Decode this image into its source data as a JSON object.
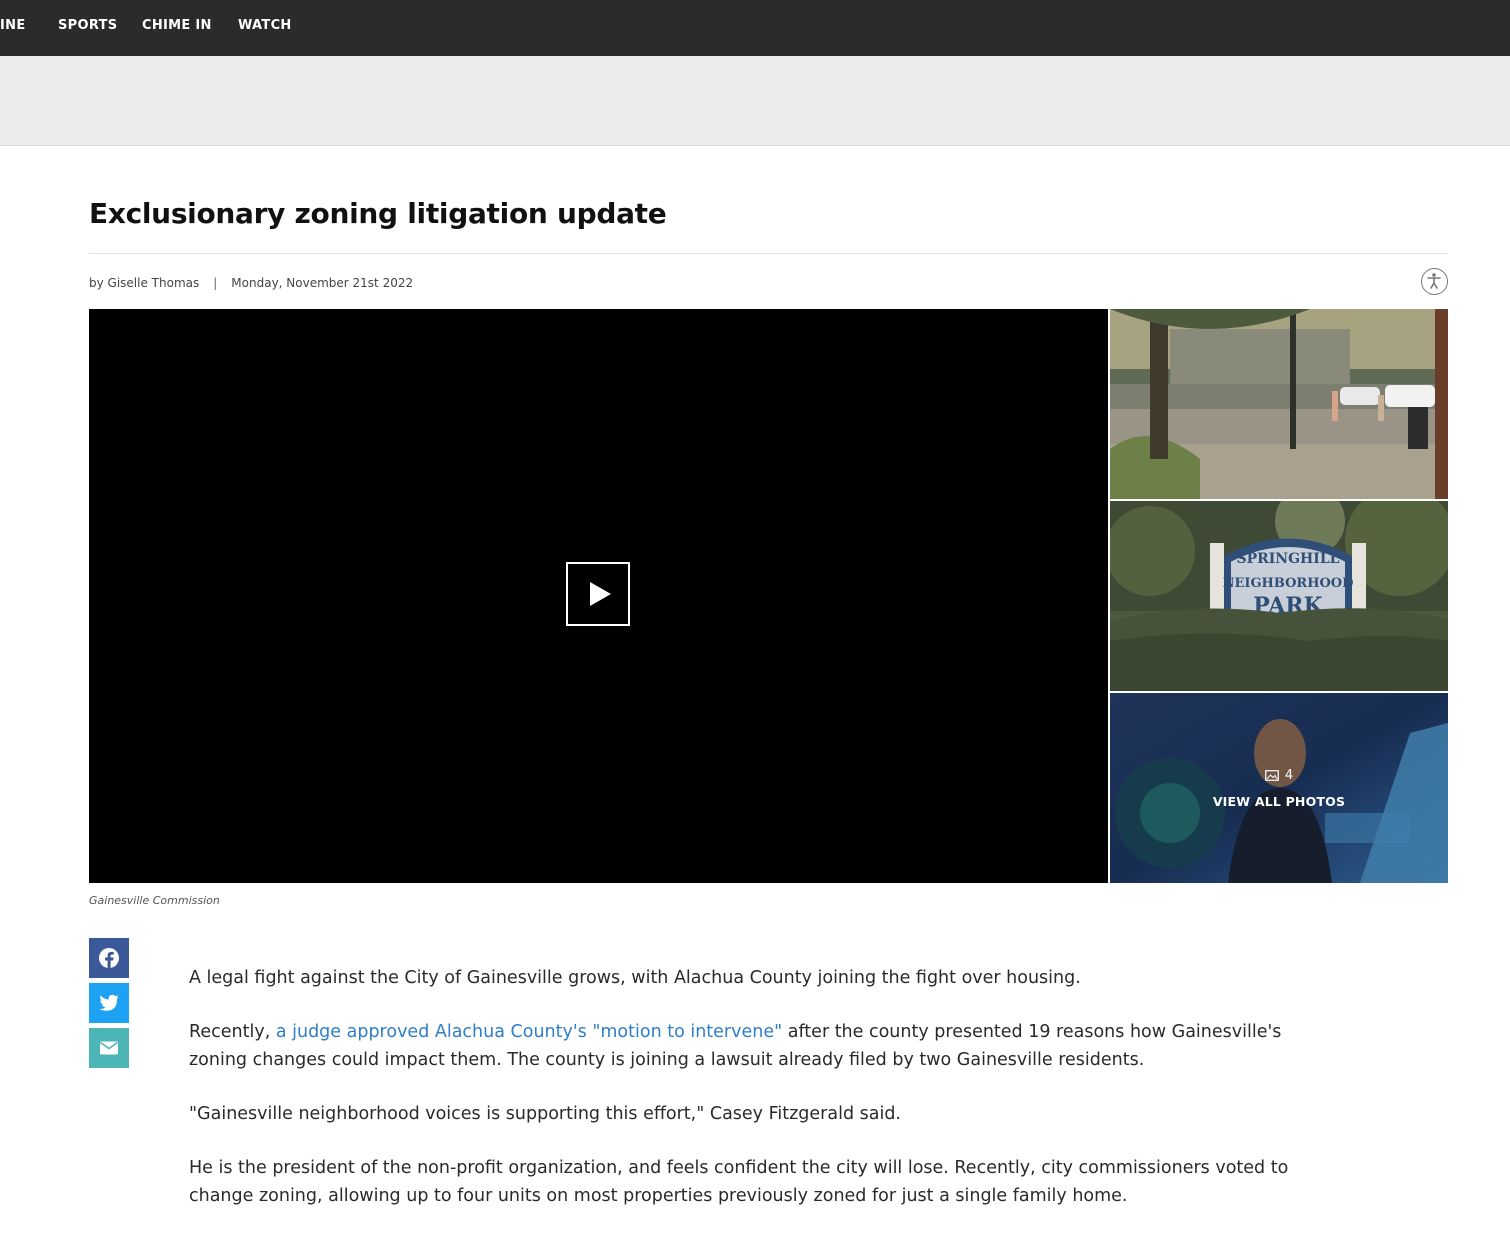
{
  "nav": {
    "items": [
      "INE",
      "SPORTS",
      "CHIME IN",
      "WATCH"
    ]
  },
  "article": {
    "headline": "Exclusionary zoning litigation update",
    "byline": "by Giselle Thomas",
    "byline_separator": "|",
    "date": "Monday, November 21st 2022",
    "caption": "Gainesville Commission",
    "gallery": {
      "photo_count": "4",
      "view_all_label": "VIEW ALL PHOTOS",
      "sign_line1": "SPRINGHILL",
      "sign_line2": "NEIGHBORHOOD",
      "sign_line3": "PARK"
    },
    "paragraphs": {
      "p1": "A legal fight against the City of Gainesville grows, with Alachua County joining the fight over housing.",
      "p2_before": "Recently, ",
      "p2_link": "a judge approved Alachua County's \"motion to intervene\"",
      "p2_after": " after the county presented 19 reasons how Gainesville's zoning changes could impact them. The county is joining a lawsuit already filed by two Gainesville residents.",
      "p3": "\"Gainesville neighborhood voices is supporting this effort,\" Casey Fitzgerald said.",
      "p4": "He is the president of the non-profit organization, and feels confident the city will lose. Recently, city commissioners voted to change zoning, allowing up to four units on most properties previously zoned for just a single family home."
    }
  },
  "share": {
    "icons": [
      "facebook-icon",
      "twitter-icon",
      "email-icon"
    ]
  },
  "colors": {
    "nav_bg": "#2b2b2b",
    "ad_band_bg": "#ececec",
    "link": "#2f7ec7",
    "facebook": "#3b5998",
    "twitter": "#1da1f2",
    "email": "#4db5b5"
  }
}
